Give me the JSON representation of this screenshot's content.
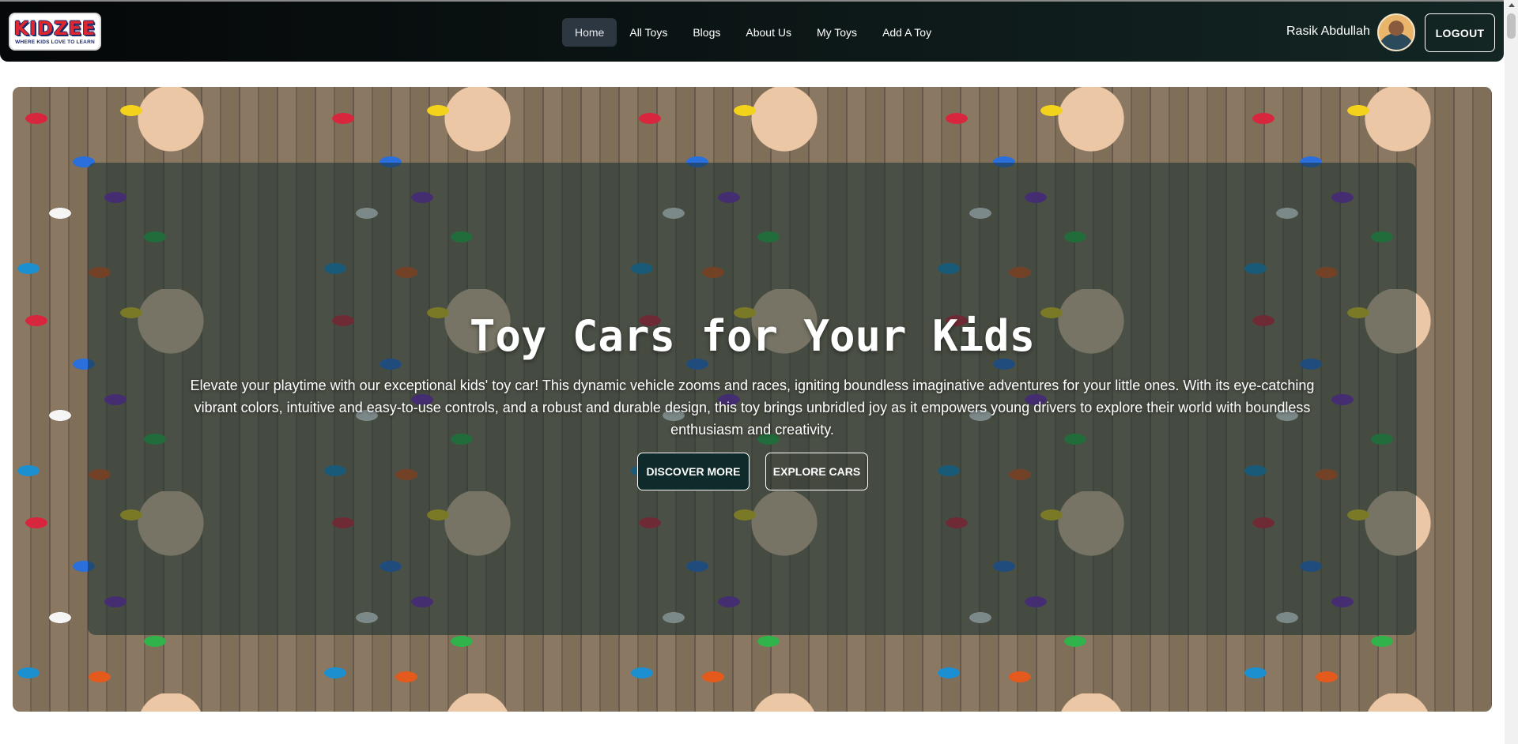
{
  "brand": {
    "logo_word": "KIDZEE",
    "logo_tagline": "WHERE KIDS LOVE TO LEARN"
  },
  "nav": {
    "items": [
      {
        "label": "Home"
      },
      {
        "label": "All Toys"
      },
      {
        "label": "Blogs"
      },
      {
        "label": "About Us"
      },
      {
        "label": "My Toys"
      },
      {
        "label": "Add A Toy"
      }
    ],
    "active": "Home"
  },
  "user": {
    "name": "Rasik Abdullah",
    "logout_label": "LOGOUT"
  },
  "hero": {
    "title": "Toy Cars for Your Kids",
    "description": "Elevate your playtime with our exceptional kids' toy car! This dynamic vehicle zooms and races, igniting boundless imaginative adventures for your little ones. With its eye-catching vibrant colors, intuitive and easy-to-use controls, and a robust and durable design, this toy brings unbridled joy as it empowers young drivers to explore their world with boundless enthusiasm and creativity.",
    "primary_button": "DISCOVER MORE",
    "secondary_button": "EXPLORE CARS"
  },
  "colors": {
    "navbar_dark": "#050708",
    "navbar_teal": "#132624",
    "active_tab_bg": "#2d3741",
    "primary_button_bg": "#0f2a2a",
    "overlay": "#183030"
  }
}
